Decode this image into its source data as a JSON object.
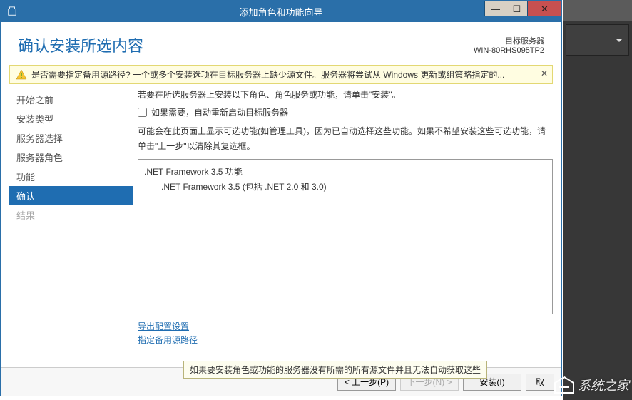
{
  "titlebar": {
    "title": "添加角色和功能向导"
  },
  "header": {
    "page_title": "确认安装所选内容",
    "target_label": "目标服务器",
    "target_name": "WIN-80RHS095TP2"
  },
  "warning": {
    "text": "是否需要指定备用源路径? 一个或多个安装选项在目标服务器上缺少源文件。服务器将尝试从 Windows 更新或组策略指定的..."
  },
  "sidebar": {
    "items": [
      {
        "label": "开始之前",
        "state": "active-prev"
      },
      {
        "label": "安装类型",
        "state": "active-prev"
      },
      {
        "label": "服务器选择",
        "state": "active-prev"
      },
      {
        "label": "服务器角色",
        "state": "active-prev"
      },
      {
        "label": "功能",
        "state": "active-prev"
      },
      {
        "label": "确认",
        "state": "active"
      },
      {
        "label": "结果",
        "state": "disabled"
      }
    ]
  },
  "main": {
    "instr": "若要在所选服务器上安装以下角色、角色服务或功能，请单击\"安装\"。",
    "checkbox_label": "如果需要，自动重新启动目标服务器",
    "desc": "可能会在此页面上显示可选功能(如管理工具)，因为已自动选择这些功能。如果不希望安装这些可选功能，请单击\"上一步\"以清除其复选框。",
    "list": {
      "l1": ".NET Framework 3.5 功能",
      "l2": ".NET Framework 3.5 (包括 .NET 2.0 和 3.0)"
    },
    "links": {
      "export": "导出配置设置",
      "altpath": "指定备用源路径"
    }
  },
  "tooltip": "如果要安装角色或功能的服务器没有所需的所有源文件并且无法自动获取这些",
  "footer": {
    "prev": "< 上一步(P)",
    "next": "下一步(N) >",
    "install": "安装(I)",
    "cancel": "取"
  },
  "watermark": "系统之家"
}
